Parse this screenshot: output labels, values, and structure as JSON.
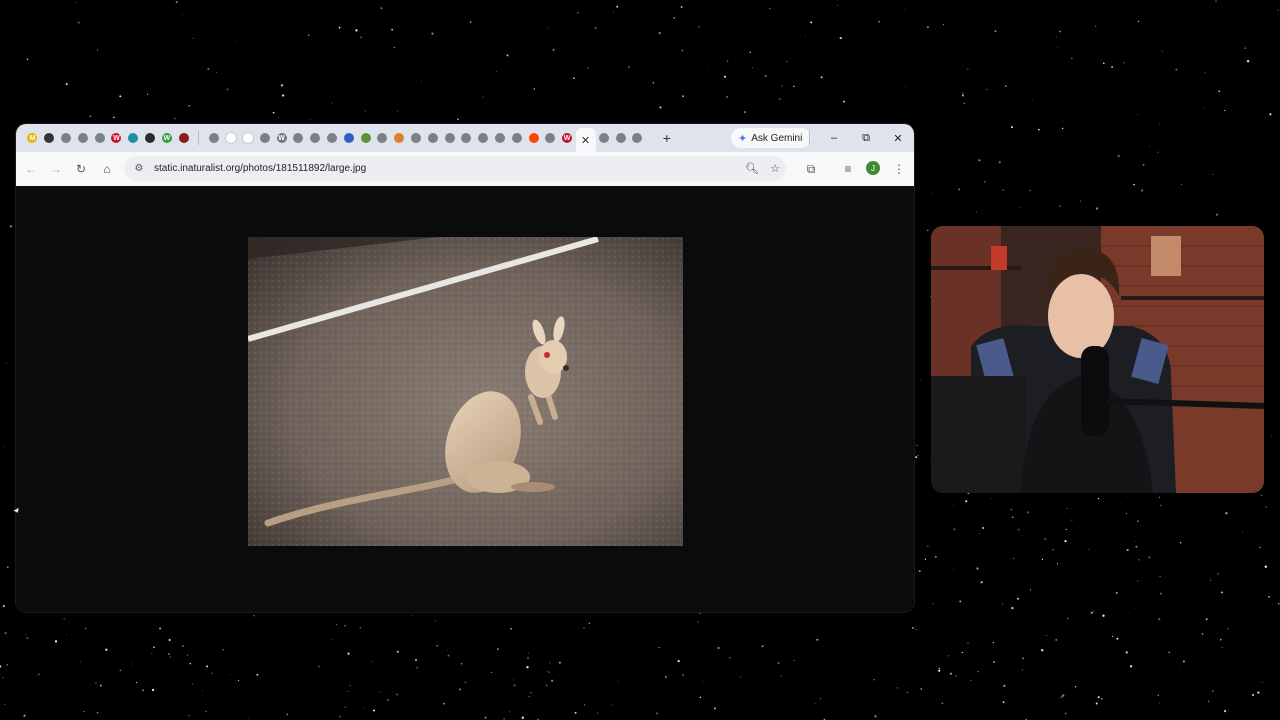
{
  "browser": {
    "tabs": [
      {
        "icon": "app-icon",
        "color": "#e8b400",
        "glyph": "M"
      },
      {
        "icon": "app-icon",
        "color": "#333333",
        "glyph": ""
      },
      {
        "icon": "globe-icon",
        "color": "#7a7f88",
        "glyph": ""
      },
      {
        "icon": "globe-icon",
        "color": "#7a7f88",
        "glyph": ""
      },
      {
        "icon": "globe-icon",
        "color": "#7a7f88",
        "glyph": ""
      },
      {
        "icon": "w-icon",
        "color": "#c8102e",
        "glyph": "W"
      },
      {
        "icon": "globe-icon",
        "color": "#1f8fa8",
        "glyph": ""
      },
      {
        "icon": "bird-icon",
        "color": "#2b2b2b",
        "glyph": ""
      },
      {
        "icon": "w-icon",
        "color": "#2e9e3e",
        "glyph": "W"
      },
      {
        "icon": "record-icon",
        "color": "#8e1a1a",
        "glyph": ""
      },
      {
        "sep": true
      },
      {
        "icon": "globe-icon",
        "color": "#7a7f88",
        "glyph": ""
      },
      {
        "icon": "blank-icon",
        "color": "#ffffff",
        "glyph": ""
      },
      {
        "icon": "blank-icon",
        "color": "#ffffff",
        "glyph": ""
      },
      {
        "icon": "globe-icon",
        "color": "#7a7f88",
        "glyph": ""
      },
      {
        "icon": "wordpress-icon",
        "color": "#6f7a88",
        "glyph": "W"
      },
      {
        "icon": "globe-icon",
        "color": "#7a7f88",
        "glyph": ""
      },
      {
        "icon": "globe-icon",
        "color": "#7a7f88",
        "glyph": ""
      },
      {
        "icon": "globe-icon",
        "color": "#7a7f88",
        "glyph": ""
      },
      {
        "icon": "globe-icon",
        "color": "#2d5fc4",
        "glyph": ""
      },
      {
        "icon": "globe-icon",
        "color": "#5f8f3a",
        "glyph": ""
      },
      {
        "icon": "globe-icon",
        "color": "#7a7f88",
        "glyph": ""
      },
      {
        "icon": "star-icon",
        "color": "#d9822b",
        "glyph": ""
      },
      {
        "icon": "globe-icon",
        "color": "#7a7f88",
        "glyph": ""
      },
      {
        "icon": "globe-icon",
        "color": "#7a7f88",
        "glyph": ""
      },
      {
        "icon": "globe-icon",
        "color": "#7a7f88",
        "glyph": ""
      },
      {
        "icon": "globe-icon",
        "color": "#7a7f88",
        "glyph": ""
      },
      {
        "icon": "globe-icon",
        "color": "#7a7f88",
        "glyph": ""
      },
      {
        "icon": "globe-icon",
        "color": "#7a7f88",
        "glyph": ""
      },
      {
        "icon": "globe-icon",
        "color": "#7a7f88",
        "glyph": ""
      },
      {
        "icon": "reddit-icon",
        "color": "#ff4500",
        "glyph": ""
      },
      {
        "icon": "globe-icon",
        "color": "#7a7f88",
        "glyph": ""
      },
      {
        "icon": "w-icon",
        "color": "#c8102e",
        "glyph": "W"
      },
      {
        "active": true
      },
      {
        "icon": "globe-icon",
        "color": "#7a7f88",
        "glyph": ""
      },
      {
        "icon": "globe-icon",
        "color": "#7a7f88",
        "glyph": ""
      },
      {
        "icon": "globe-icon",
        "color": "#7a7f88",
        "glyph": ""
      }
    ],
    "new_tab": "+",
    "active_tab_close": "✕",
    "gemini_label": "Ask Gemini",
    "window_controls": {
      "minimize": "–",
      "restore": "⧉",
      "close": "✕"
    },
    "url": "static.inaturalist.org/photos/181511892/large.jpg",
    "profile_initial": "J"
  },
  "content": {
    "image_subject": "wallaby on road at night"
  }
}
